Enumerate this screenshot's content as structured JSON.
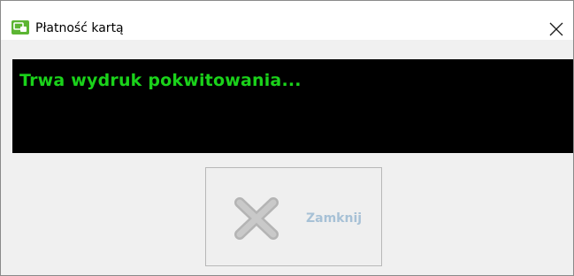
{
  "window": {
    "title": "Płatność kartą",
    "app_icon": "card-terminal-icon",
    "close_icon": "close-icon"
  },
  "message": {
    "text": "Trwa wydruk pokwitowania...",
    "background_color": "#000000",
    "text_color": "#1ad21a"
  },
  "close_button": {
    "label": "Zamknij",
    "icon": "x-icon",
    "state": "disabled",
    "label_color": "#a7c1d6"
  }
}
